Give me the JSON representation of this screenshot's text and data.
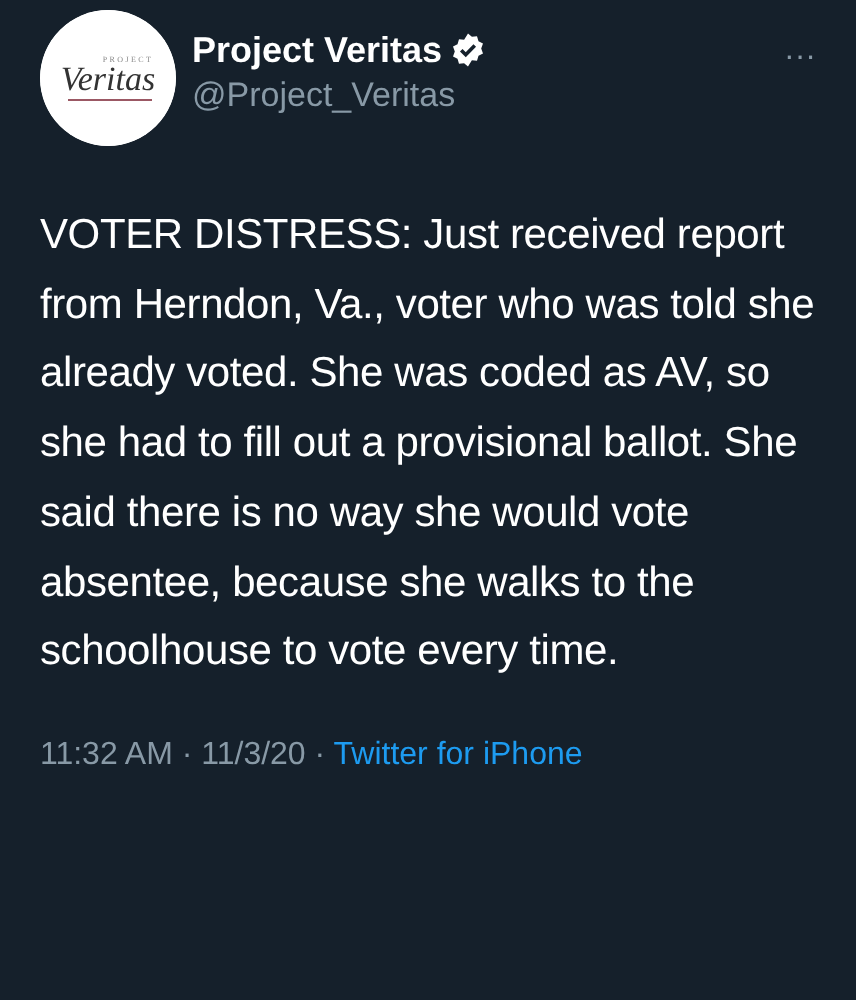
{
  "tweet": {
    "avatar": {
      "logo_top": "PROJECT",
      "logo_main": "Veritas"
    },
    "name": "Project Veritas",
    "verified": true,
    "handle": "@Project_Veritas",
    "more": "···",
    "text": "VOTER DISTRESS: Just received report from Herndon, Va., voter who was told she already voted. She was coded as AV, so she had to fill out a provisional ballot. She said there is no way she would vote absentee, because she walks to the schoolhouse to vote every time.",
    "time": "11:32 AM",
    "date": "11/3/20",
    "separator": "·",
    "source": "Twitter for iPhone"
  }
}
